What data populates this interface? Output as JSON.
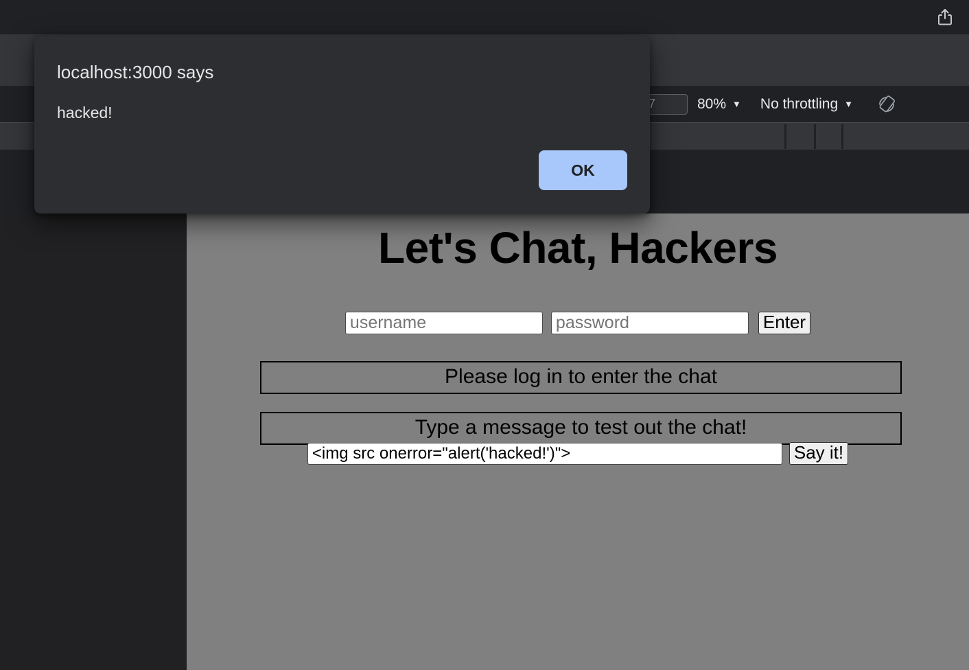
{
  "devtools": {
    "share_icon": "share-export-icon",
    "device_width_value": "7",
    "device_width_placeholder": "",
    "zoom_label": "80%",
    "throttling_label": "No throttling",
    "caret_glyph": "▼",
    "rotate_icon": "rotate-device-icon"
  },
  "page": {
    "title": "Let's Chat, Hackers",
    "username_placeholder": "username",
    "username_value": "",
    "password_placeholder": "password",
    "password_value": "",
    "enter_button": "Enter",
    "notice_login": "Please log in to enter the chat",
    "notice_type": "Type a message to test out the chat!",
    "message_value": "<img src onerror=\"alert('hacked!')\">",
    "message_placeholder": "",
    "say_button": "Say it!"
  },
  "alert": {
    "origin": "localhost:3000 says",
    "message": "hacked!",
    "ok_button": "OK"
  },
  "colors": {
    "accent_button": "#a8c7fa",
    "dialog_bg": "#2d2e31",
    "viewport_bg": "#808080",
    "devtools_bg": "#202124"
  }
}
